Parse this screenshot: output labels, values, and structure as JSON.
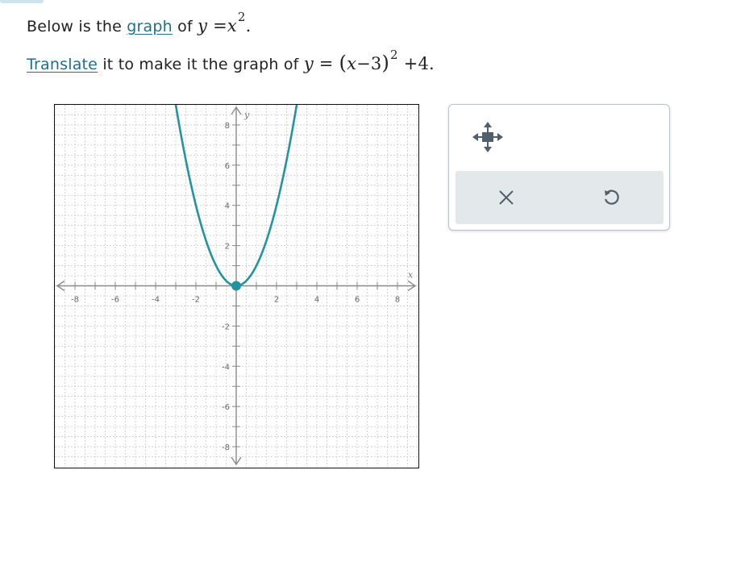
{
  "prompt": {
    "line1": {
      "prefix": "Below is the",
      "link": "graph",
      "middle": "of",
      "eq_lhs": "y",
      "eq_sign": "=",
      "eq_var": "x",
      "eq_exp": "2",
      "suffix": "."
    },
    "line2": {
      "link": "Translate",
      "middle": "it to make it the graph of",
      "eq_lhs": "y",
      "eq_sign": "=",
      "eq_open": "(",
      "eq_var": "x",
      "eq_minus": "−",
      "eq_shift": "3",
      "eq_close": ")",
      "eq_exp": "2",
      "eq_plus": "+4",
      "suffix": "."
    }
  },
  "graph": {
    "xlabel": "x",
    "ylabel": "y",
    "xlim": [
      -9,
      9
    ],
    "ylim": [
      -9,
      9
    ],
    "x_ticks": [
      "-8",
      "-6",
      "-4",
      "-2",
      "2",
      "4",
      "6",
      "8"
    ],
    "y_ticks": [
      "8",
      "6",
      "4",
      "2",
      "-2",
      "-4",
      "-6",
      "-8"
    ],
    "grid": true,
    "curve_color": "#23939f",
    "vertex": {
      "x": 0,
      "y": 0
    },
    "curve_equation": "y = x^2"
  },
  "tools": {
    "move_icon": "move-arrows-icon",
    "clear_icon": "close-icon",
    "undo_icon": "undo-icon",
    "icon_color": "#4f5f6b"
  }
}
